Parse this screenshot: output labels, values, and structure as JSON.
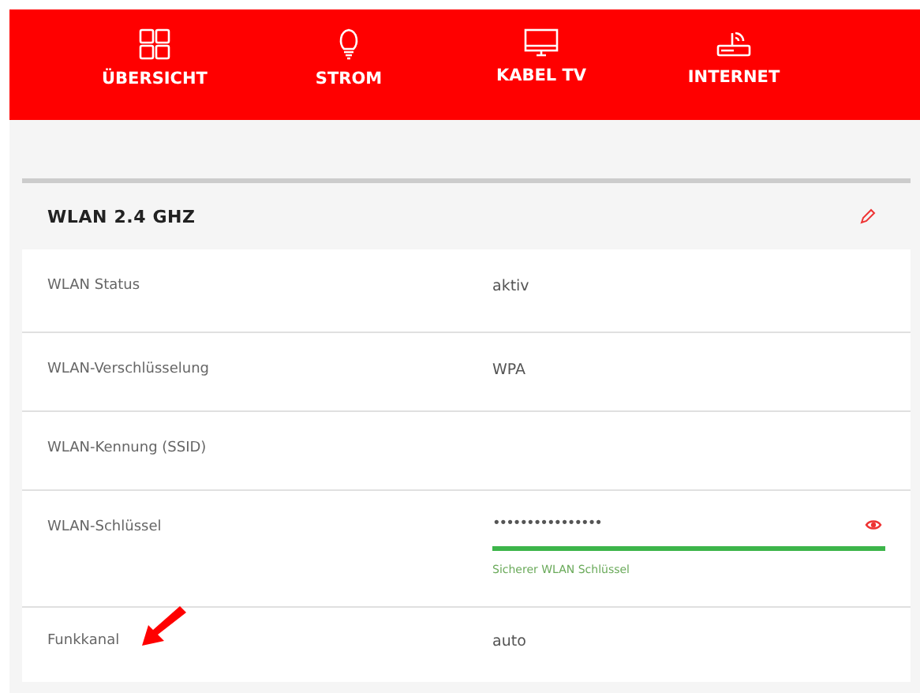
{
  "nav": [
    {
      "label": "ÜBERSICHT"
    },
    {
      "label": "STROM"
    },
    {
      "label": "KABEL TV"
    },
    {
      "label": "INTERNET"
    }
  ],
  "section": {
    "title": "WLAN 2.4 GHZ"
  },
  "rows": [
    {
      "kind": "text",
      "label": "WLAN Status",
      "value": "aktiv",
      "annotated": false
    },
    {
      "kind": "text",
      "label": "WLAN-Verschlüsselung",
      "value": "WPA",
      "annotated": false
    },
    {
      "kind": "empty",
      "label": "WLAN-Kennung (SSID)"
    },
    {
      "kind": "password",
      "label": "WLAN-Schlüssel",
      "value": "••••••••••••••••",
      "level": 1,
      "hint": "Sicherer WLAN Schlüssel"
    },
    {
      "kind": "text",
      "label": "Funkkanal",
      "value": "auto",
      "annotated": true
    }
  ]
}
